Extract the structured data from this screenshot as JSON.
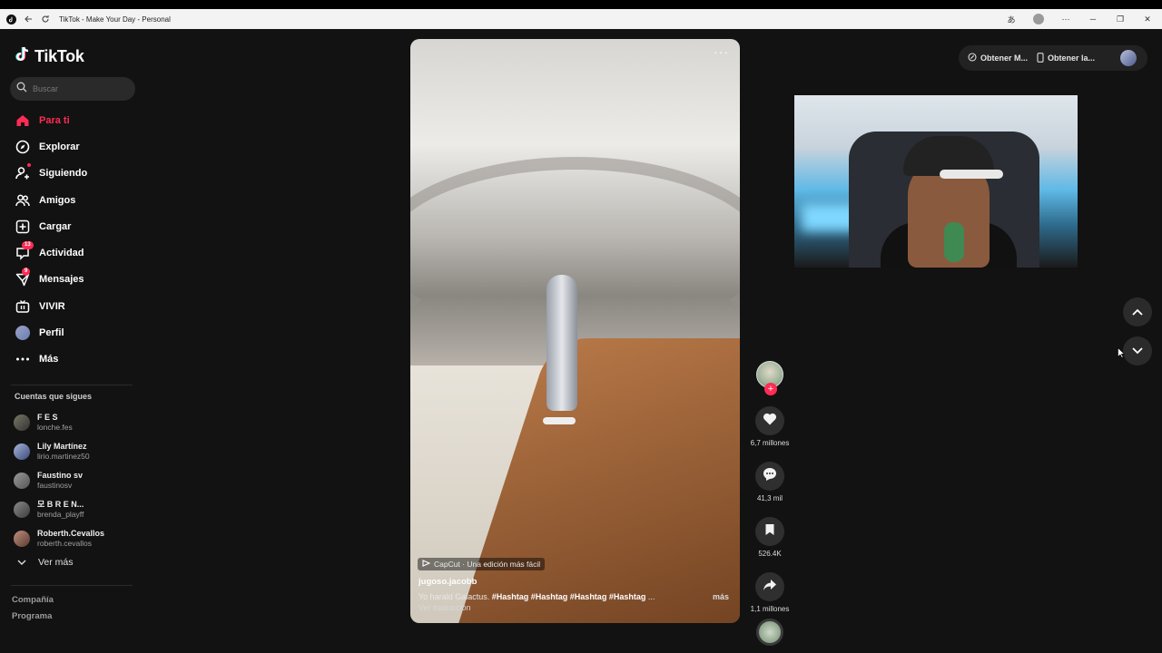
{
  "browser": {
    "title": "TikTok - Make Your Day - Personal"
  },
  "app": {
    "logo_text": "TikTok"
  },
  "search": {
    "placeholder": "Buscar"
  },
  "nav": {
    "items": [
      {
        "label": "Para ti",
        "icon": "home-icon",
        "active": true
      },
      {
        "label": "Explorar",
        "icon": "compass-icon"
      },
      {
        "label": "Siguiendo",
        "icon": "following-icon"
      },
      {
        "label": "Amigos",
        "icon": "friends-icon"
      },
      {
        "label": "Cargar",
        "icon": "upload-icon"
      },
      {
        "label": "Actividad",
        "icon": "activity-icon",
        "badge": "13"
      },
      {
        "label": "Mensajes",
        "icon": "messages-icon",
        "badge": "9"
      },
      {
        "label": "VIVIR",
        "icon": "live-icon"
      },
      {
        "label": "Perfil",
        "icon": "avatar"
      },
      {
        "label": "Más",
        "icon": "more-icon"
      }
    ]
  },
  "following": {
    "title": "Cuentas que sigues",
    "accounts": [
      {
        "name": "F E S",
        "handle": "lonche.fes"
      },
      {
        "name": "Lily Martínez",
        "handle": "lirio.martinez50"
      },
      {
        "name": "Faustino sv",
        "handle": "faustinosv"
      },
      {
        "name": "모 B R E N...",
        "handle": "brenda_playff"
      },
      {
        "name": "Roberth.Cevallos",
        "handle": "roberth.cevallos"
      }
    ],
    "see_more": "Ver más"
  },
  "footer": {
    "links": [
      "Compañía",
      "Programa"
    ]
  },
  "video": {
    "more_label": "···",
    "capcut_text": "CapCut · Una edición más fácil",
    "username": "jugoso.jacobb",
    "description": "Yo harald Galactus.",
    "hashtags": [
      "#Hashtag",
      "#Hashtag",
      "#Hashtag",
      "#Hashtag"
    ],
    "ellipsis": "...",
    "more": "más",
    "translate": "Ver traducción"
  },
  "actions": {
    "likes": "6,7 millones",
    "comments": "41,3 mil",
    "saves": "526.4K",
    "shares": "1,1 millones"
  },
  "top_right": {
    "pill_1": "Obtener M...",
    "pill_2": "Obtener la..."
  },
  "colors": {
    "accent": "#fe2c55",
    "background": "#121212"
  }
}
